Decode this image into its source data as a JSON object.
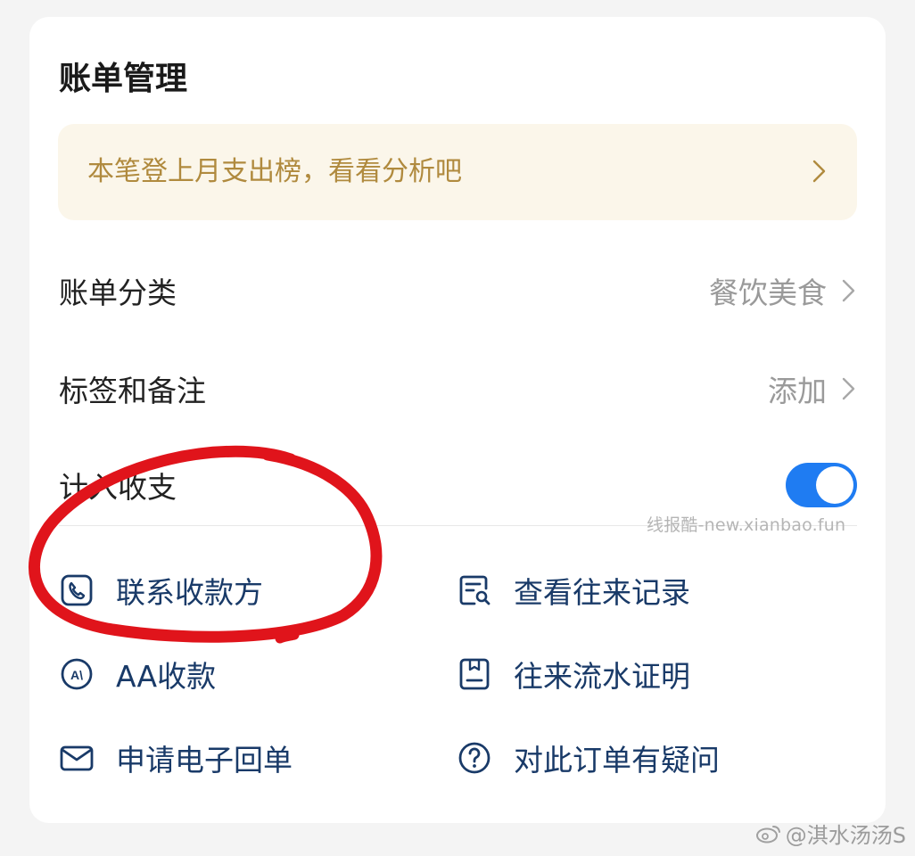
{
  "card": {
    "title": "账单管理",
    "banner": {
      "text": "本笔登上月支出榜，看看分析吧"
    },
    "rows": [
      {
        "label": "账单分类",
        "value": "餐饮美食"
      },
      {
        "label": "标签和备注",
        "value": "添加"
      },
      {
        "label": "计入收支",
        "toggle": true
      }
    ],
    "actions": [
      {
        "label": "联系收款方",
        "icon": "phone-icon"
      },
      {
        "label": "查看往来记录",
        "icon": "record-search-icon"
      },
      {
        "label": "AA收款",
        "icon": "aa-icon"
      },
      {
        "label": "往来流水证明",
        "icon": "document-icon"
      },
      {
        "label": "申请电子回单",
        "icon": "envelope-icon"
      },
      {
        "label": "对此订单有疑问",
        "icon": "question-icon"
      }
    ]
  },
  "watermarks": {
    "site": "线报酷-new.xianbao.fun",
    "weibo": "@淇水汤汤S"
  },
  "colors": {
    "accent": "#1f7cf2",
    "banner_bg": "#fbf6ea",
    "banner_text": "#b08a3e",
    "action_text": "#193a68",
    "annotation": "#e0141b"
  }
}
